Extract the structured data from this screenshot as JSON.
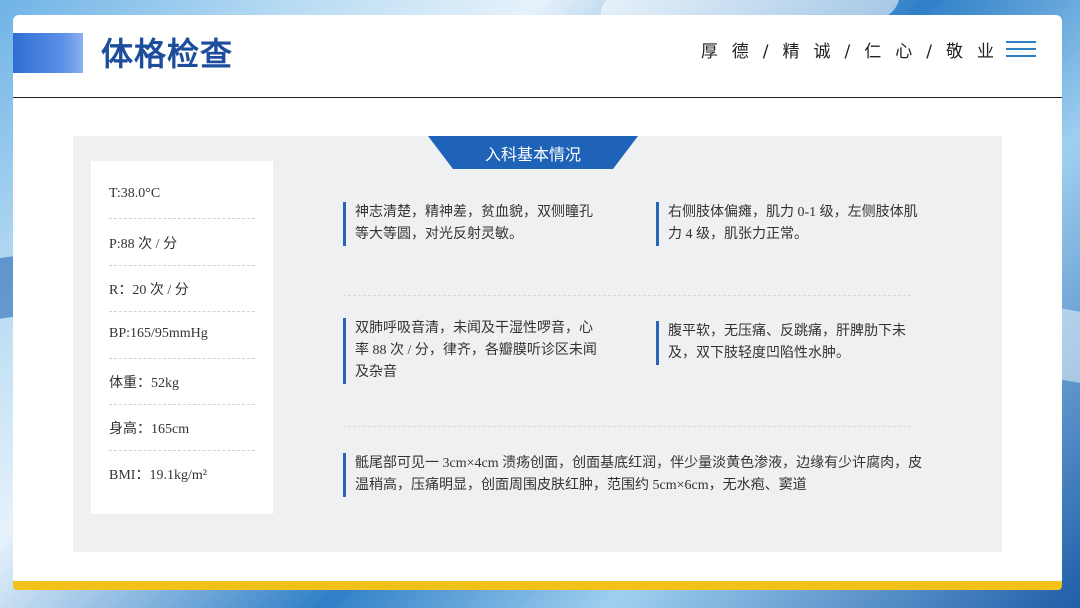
{
  "header": {
    "title": "体格检查",
    "motto": "厚德/精诚/仁心/敬业"
  },
  "panel": {
    "tab_label": "入科基本情况"
  },
  "vitals": [
    {
      "label": "T:38.0°C"
    },
    {
      "label": "P:88 次 / 分"
    },
    {
      "label": "R：20 次 / 分"
    },
    {
      "label": "BP:165/95mmHg"
    },
    {
      "label": "体重：52kg"
    },
    {
      "label": "身高：165cm"
    },
    {
      "label": "BMI：19.1kg/m²"
    }
  ],
  "findings": {
    "neuro": "神志清楚，精神差，贫血貌，双侧瞳孔等大等圆，对光反射灵敏。",
    "limbs": "右侧肢体偏瘫，肌力 0-1 级，左侧肢体肌力 4 级，肌张力正常。",
    "cardiopulmonary": "双肺呼吸音清，未闻及干湿性啰音，心率 88 次 / 分，律齐，各瓣膜听诊区未闻及杂音",
    "abdomen": "腹平软，无压痛、反跳痛，肝脾肋下未及，双下肢轻度凹陷性水肿。",
    "wound": "骶尾部可见一 3cm×4cm 溃疡创面，创面基底红润，伴少量淡黄色渗液，边缘有少许腐肉，皮温稍高，压痛明显，创面周围皮肤红肿，范围约 5cm×6cm，无水疱、窦道"
  },
  "colors": {
    "accent": "#1d4e9c",
    "tab": "#1e63b8",
    "bottom_bar": "#f2c21a"
  }
}
